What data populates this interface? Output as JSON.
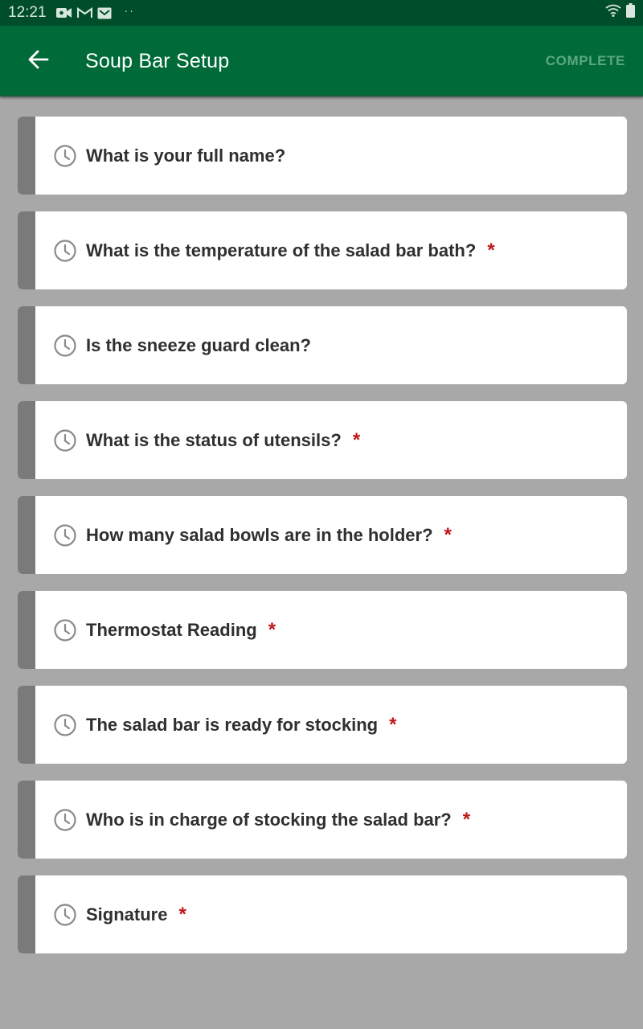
{
  "status_bar": {
    "time": "12:21",
    "icons": [
      "video-icon",
      "gmail-icon",
      "mail-icon",
      "more-dots-icon",
      "wifi-icon",
      "battery-icon"
    ]
  },
  "app_bar": {
    "title": "Soup Bar Setup",
    "complete_label": "COMPLETE",
    "back_icon": "arrow-back-icon"
  },
  "colors": {
    "status_bar": "#004d2a",
    "app_bar": "#006b38",
    "complete_disabled": "#5da77c",
    "background": "#a8a8a8",
    "required": "#c0161b"
  },
  "questions": [
    {
      "label": "What is your full name?",
      "required": ""
    },
    {
      "label": "What is the temperature of the salad bar bath?",
      "required": "*"
    },
    {
      "label": "Is the sneeze guard clean?",
      "required": ""
    },
    {
      "label": "What is the status of utensils?",
      "required": "*"
    },
    {
      "label": "How many salad bowls are in the holder?",
      "required": "*"
    },
    {
      "label": "Thermostat Reading",
      "required": "*"
    },
    {
      "label": "The salad bar is ready for stocking",
      "required": "*"
    },
    {
      "label": "Who is in charge of stocking the salad bar?",
      "required": "*"
    },
    {
      "label": "Signature",
      "required": "*"
    }
  ]
}
